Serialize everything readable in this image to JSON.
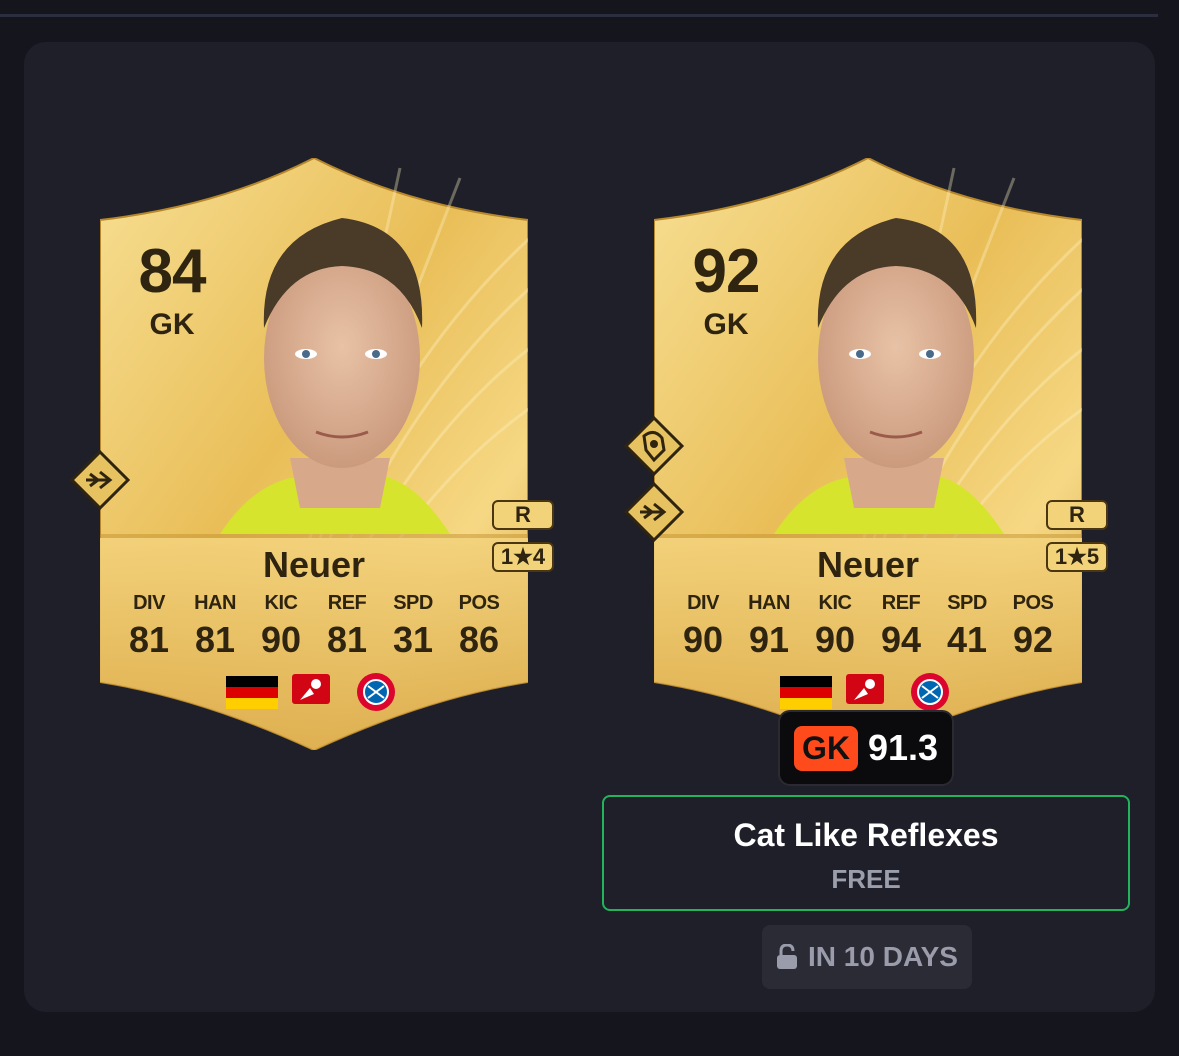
{
  "cards": [
    {
      "id": "base",
      "rating": "84",
      "position": "GK",
      "preferred_foot": "R",
      "skill_moves": "1★4",
      "name": "Neuer",
      "stats": [
        {
          "label": "DIV",
          "value": "81"
        },
        {
          "label": "HAN",
          "value": "81"
        },
        {
          "label": "KIC",
          "value": "90"
        },
        {
          "label": "REF",
          "value": "81"
        },
        {
          "label": "SPD",
          "value": "31"
        },
        {
          "label": "POS",
          "value": "86"
        }
      ],
      "playstyles": [
        "rush-out-playstyle-icon"
      ],
      "nation": "Germany flag",
      "league": "Bundesliga",
      "club": "FC Bayern München"
    },
    {
      "id": "upgraded",
      "rating": "92",
      "position": "GK",
      "preferred_foot": "R",
      "skill_moves": "1★5",
      "name": "Neuer",
      "stats": [
        {
          "label": "DIV",
          "value": "90"
        },
        {
          "label": "HAN",
          "value": "91"
        },
        {
          "label": "KIC",
          "value": "90"
        },
        {
          "label": "REF",
          "value": "94"
        },
        {
          "label": "SPD",
          "value": "41"
        },
        {
          "label": "POS",
          "value": "92"
        }
      ],
      "playstyles": [
        "glove-playstyle-icon",
        "rush-out-playstyle-icon"
      ],
      "nation": "Germany flag",
      "league": "Bundesliga",
      "club": "FC Bayern München"
    }
  ],
  "rating_badge": {
    "tag": "GK",
    "score": "91.3"
  },
  "objective": {
    "title": "Cat Like Reflexes",
    "price": "FREE"
  },
  "unlock": {
    "label": "IN 10 DAYS"
  },
  "colors": {
    "background": "#15161d",
    "panel": "#1e1f29",
    "gold_light": "#f6dc8c",
    "gold_dark": "#c99a32",
    "text_dark": "#2e2410",
    "badge_orange": "#ff4a1c",
    "objective_border": "#23b35d",
    "muted_text": "#9b9eab"
  }
}
